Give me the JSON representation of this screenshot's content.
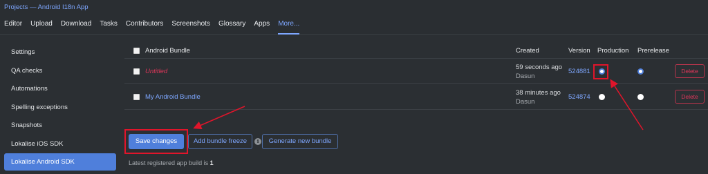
{
  "breadcrumb": {
    "projects": "Projects",
    "separator": " — ",
    "project": "Android I18n App"
  },
  "tabs": [
    "Editor",
    "Upload",
    "Download",
    "Tasks",
    "Contributors",
    "Screenshots",
    "Glossary",
    "Apps",
    "More..."
  ],
  "active_tab": "More...",
  "sidebar": {
    "items": [
      "Settings",
      "QA checks",
      "Automations",
      "Spelling exceptions",
      "Snapshots",
      "Lokalise iOS SDK",
      "Lokalise Android SDK"
    ],
    "active": "Lokalise Android SDK"
  },
  "table": {
    "headers": {
      "bundle": "Android Bundle",
      "created": "Created",
      "version": "Version",
      "production": "Production",
      "prerelease": "Prerelease"
    },
    "rows": [
      {
        "name": "Untitled",
        "created": "59 seconds ago",
        "author": "Dasun",
        "version": "524881",
        "production": true,
        "prerelease": true,
        "delete_label": "Delete"
      },
      {
        "name": "My Android Bundle",
        "created": "38 minutes ago",
        "author": "Dasun",
        "version": "524874",
        "production": false,
        "prerelease": false,
        "delete_label": "Delete"
      }
    ]
  },
  "actions": {
    "save": "Save changes",
    "freeze": "Add bundle freeze",
    "info_icon": "i",
    "generate": "Generate new bundle"
  },
  "footer": {
    "text": "Latest registered app build is",
    "build": "1"
  },
  "colors": {
    "accent": "#4f7fdb",
    "link": "#7ea7ff",
    "danger": "#e0365a",
    "annotation": "#e0152b",
    "background": "#2b2f33"
  }
}
